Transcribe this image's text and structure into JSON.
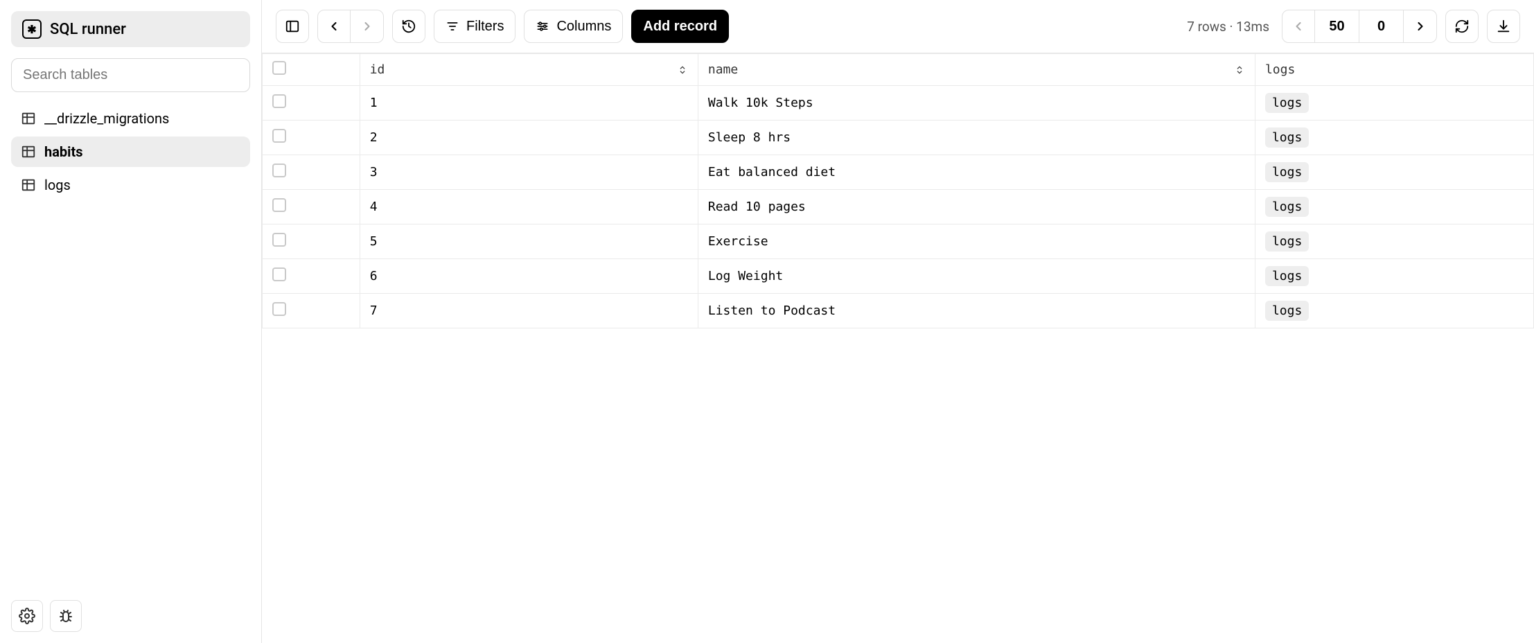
{
  "sidebar": {
    "sql_runner_label": "SQL runner",
    "search_placeholder": "Search tables",
    "tables": [
      {
        "label": "__drizzle_migrations",
        "active": false
      },
      {
        "label": "habits",
        "active": true
      },
      {
        "label": "logs",
        "active": false
      }
    ]
  },
  "toolbar": {
    "filters_label": "Filters",
    "columns_label": "Columns",
    "add_record_label": "Add record",
    "status_text": "7 rows · 13ms",
    "page_size": "50",
    "page_offset": "0"
  },
  "table": {
    "columns": {
      "id": "id",
      "name": "name",
      "logs": "logs"
    },
    "logs_badge": "logs",
    "rows": [
      {
        "id": "1",
        "name": "Walk 10k Steps"
      },
      {
        "id": "2",
        "name": "Sleep 8 hrs"
      },
      {
        "id": "3",
        "name": "Eat balanced diet"
      },
      {
        "id": "4",
        "name": "Read 10 pages"
      },
      {
        "id": "5",
        "name": "Exercise"
      },
      {
        "id": "6",
        "name": "Log Weight"
      },
      {
        "id": "7",
        "name": "Listen to Podcast"
      }
    ]
  }
}
